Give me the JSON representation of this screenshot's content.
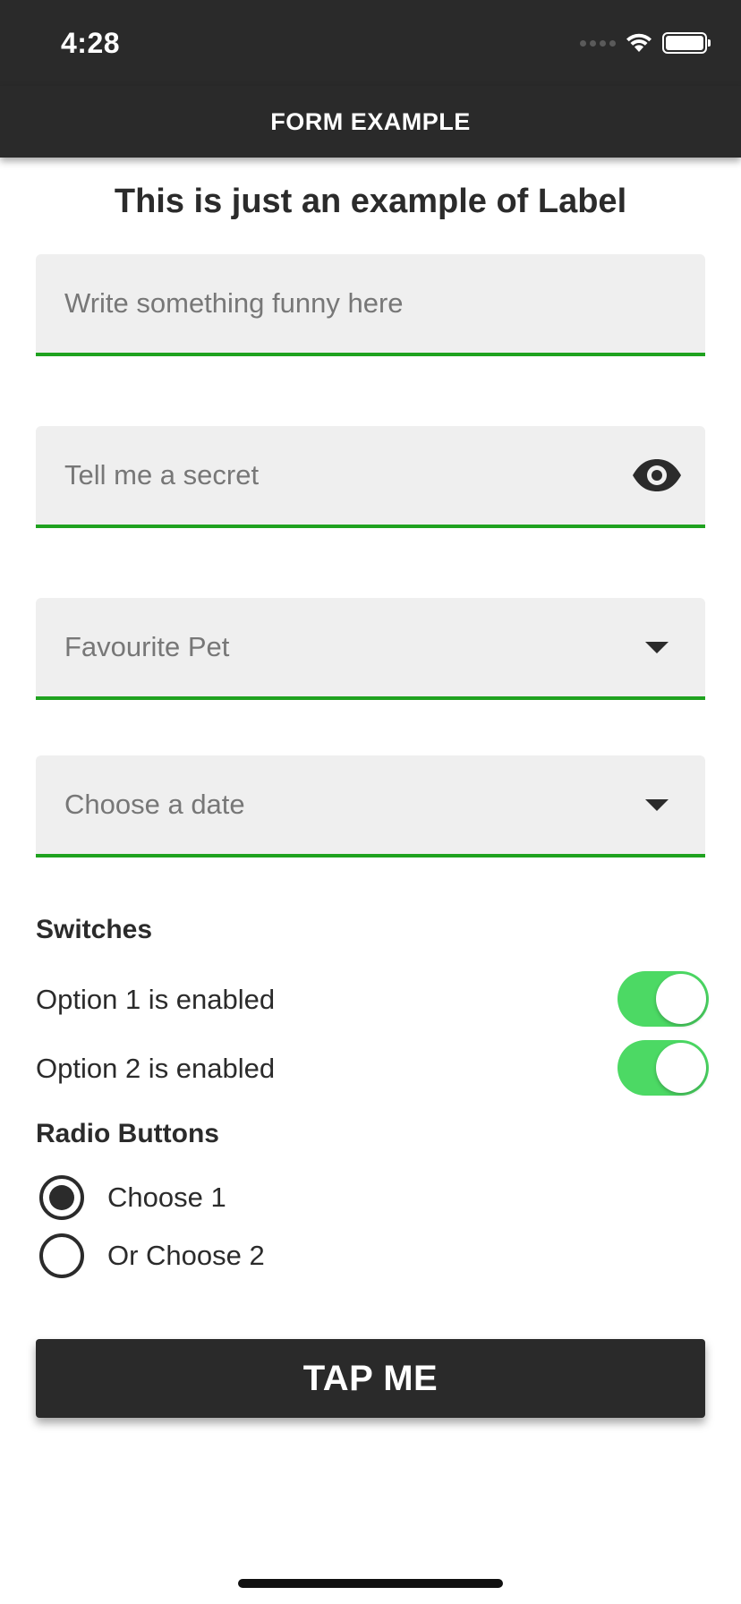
{
  "status_bar": {
    "time": "4:28",
    "icons": [
      "cellular-icon",
      "wifi-icon",
      "battery-icon"
    ]
  },
  "nav": {
    "title": "FORM EXAMPLE"
  },
  "label": {
    "text": "This is just an example of Label"
  },
  "fields": [
    {
      "placeholder": "Write something funny here",
      "trailing_icon": null
    },
    {
      "placeholder": "Tell me a secret",
      "trailing_icon": "eye-icon"
    },
    {
      "placeholder": "Favourite Pet",
      "trailing_icon": "dropdown-caret-icon"
    },
    {
      "placeholder": "Choose a date",
      "trailing_icon": "dropdown-caret-icon"
    }
  ],
  "switches": {
    "title": "Switches",
    "items": [
      {
        "label": "Option 1 is enabled",
        "on": true
      },
      {
        "label": "Option 2 is enabled",
        "on": true
      }
    ]
  },
  "radios": {
    "title": "Radio Buttons",
    "items": [
      {
        "label": "Choose 1",
        "selected": true
      },
      {
        "label": "Or Choose 2",
        "selected": false
      }
    ]
  },
  "button": {
    "label": "TAP ME"
  },
  "colors": {
    "header_bg": "#2a2a2a",
    "field_bg": "#efefef",
    "field_underline": "#1fa21f",
    "switch_on": "#4cd964",
    "text": "#2b2b2b",
    "placeholder": "#777777"
  }
}
